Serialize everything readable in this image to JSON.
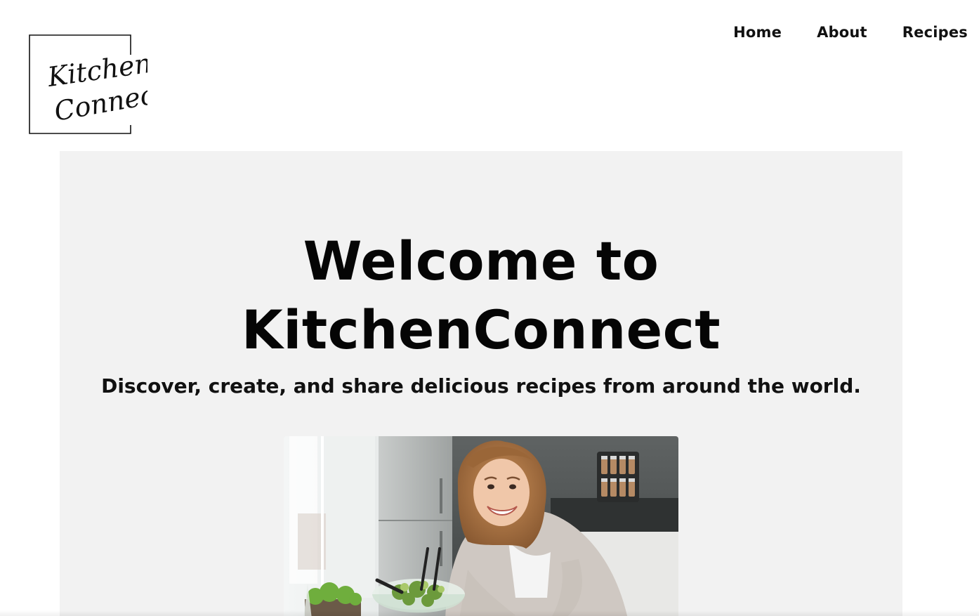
{
  "brand": {
    "logo_line1": "Kitchen",
    "logo_line2": "Connect"
  },
  "nav": {
    "items": [
      {
        "label": "Home"
      },
      {
        "label": "About"
      },
      {
        "label": "Recipes"
      }
    ]
  },
  "hero": {
    "title_line1": "Welcome to",
    "title_line2": "KitchenConnect",
    "subtitle": "Discover, create, and share delicious recipes from around the world."
  },
  "colors": {
    "hero_background": "#f2f2f2",
    "text": "#0a0a0a",
    "page_background": "#ffffff"
  }
}
